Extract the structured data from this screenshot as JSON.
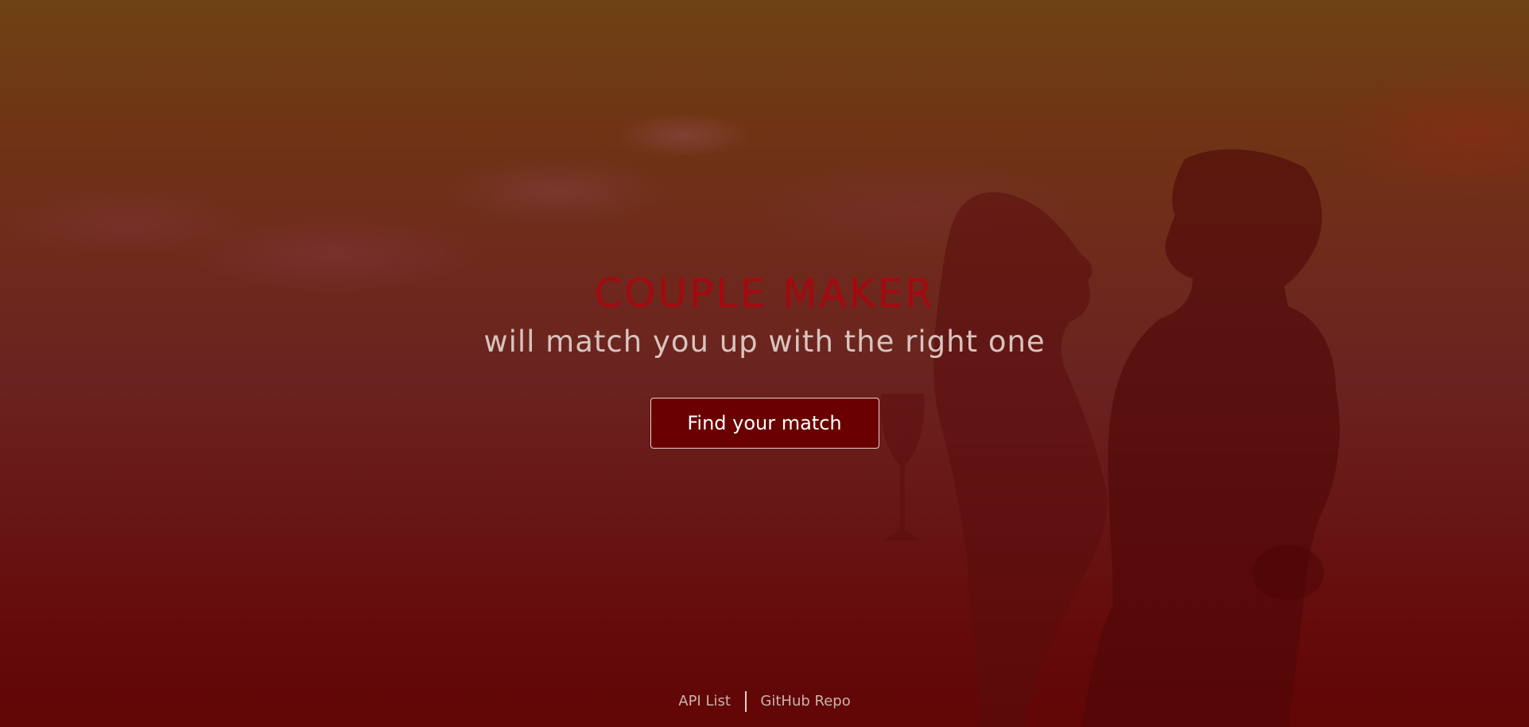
{
  "hero": {
    "title": "COUPLE MAKER",
    "subtitle": "will match you up with the right one",
    "cta_label": "Find your match"
  },
  "footer": {
    "links": [
      {
        "label": "API List"
      },
      {
        "label": "GitHub Repo"
      }
    ]
  },
  "colors": {
    "title": "#a4090f",
    "button_bg": "#6a0000",
    "overlay_top": "#6e4214",
    "overlay_bottom": "#610505"
  },
  "icons": {
    "background": "couple-silhouette-image"
  }
}
